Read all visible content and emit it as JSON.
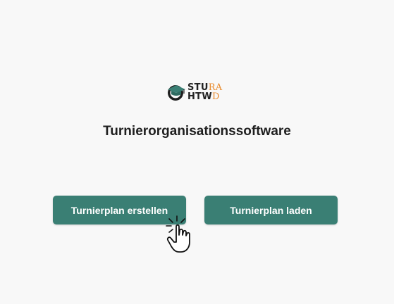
{
  "logo": {
    "line1_main": "STU",
    "line1_accent": "RA",
    "line2_main": "HTW",
    "line2_accent": "D",
    "icon": "graduation-cap-icon",
    "accent_color": "#e98a2b",
    "cap_color": "#3a7f74"
  },
  "title": "Turnierorganisationssoftware",
  "buttons": {
    "create_label": "Turnierplan erstellen",
    "load_label": "Turnierplan laden",
    "color": "#3a7f74"
  },
  "cursor": {
    "icon": "hand-pointer-click-icon"
  }
}
